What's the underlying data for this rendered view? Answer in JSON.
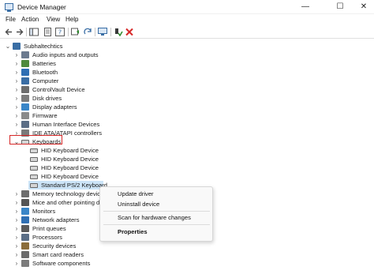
{
  "window": {
    "title": "Device Manager",
    "controls": {
      "minimize": "—",
      "maximize": "☐",
      "close": "✕"
    }
  },
  "menu": [
    "File",
    "Action",
    "View",
    "Help"
  ],
  "toolbar": [
    "back-arrow-icon",
    "forward-arrow-icon",
    "show-hide-tree-icon",
    "properties-icon",
    "help-icon",
    "update-driver-icon",
    "scan-hardware-icon",
    "enable-device-icon",
    "uninstall-icon"
  ],
  "tree": {
    "root": "Subhaltechtics",
    "categories": [
      "Audio inputs and outputs",
      "Batteries",
      "Bluetooth",
      "Computer",
      "ControlVault Device",
      "Disk drives",
      "Display adapters",
      "Firmware",
      "Human Interface Devices",
      "IDE ATA/ATAPI controllers",
      "Keyboards"
    ],
    "keyboard_children": [
      "HID Keyboard Device",
      "HID Keyboard Device",
      "HID Keyboard Device",
      "HID Keyboard Device",
      "Standard PS/2 Keyboard"
    ],
    "after_categories": [
      "Memory technology devices",
      "Mice and other pointing devices",
      "Monitors",
      "Network adapters",
      "Print queues",
      "Processors",
      "Security devices",
      "Smart card readers",
      "Software components"
    ]
  },
  "context_menu": {
    "items": [
      "Update driver",
      "Uninstall device",
      "Scan for hardware changes",
      "Properties"
    ]
  },
  "colors": {
    "highlight_border": "#d62828",
    "selection": "#cce4f7"
  }
}
